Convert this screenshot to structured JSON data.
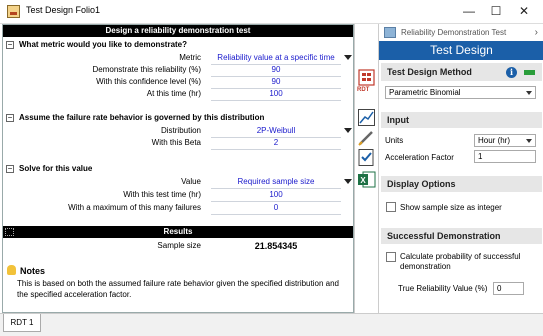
{
  "window": {
    "title": "Test Design Folio1",
    "minimize": "—",
    "maximize": "☐",
    "close": "✕"
  },
  "worksheet": {
    "banner": "Design a reliability demonstration test",
    "metric_section": {
      "header": "What metric would you like to demonstrate?",
      "rows": [
        {
          "label": "Metric",
          "value": "Reliability value at a specific time"
        },
        {
          "label": "Demonstrate this reliability (%)",
          "value": "90"
        },
        {
          "label": "With this confidence level (%)",
          "value": "90"
        },
        {
          "label": "At this time (hr)",
          "value": "100"
        }
      ]
    },
    "failure_section": {
      "header": "Assume the failure rate behavior is governed by this distribution",
      "rows": [
        {
          "label": "Distribution",
          "value": "2P-Weibull"
        },
        {
          "label": "With this Beta",
          "value": "2"
        }
      ]
    },
    "solve_section": {
      "header": "Solve for this value",
      "rows": [
        {
          "label": "Value",
          "value": "Required sample size"
        },
        {
          "label": "With this test time (hr)",
          "value": "100"
        },
        {
          "label": "With a maximum of this many failures",
          "value": "0"
        }
      ]
    },
    "results": {
      "banner": "Results",
      "label": "Sample size",
      "value": "21.854345"
    },
    "notes": {
      "title": "Notes",
      "text": "This is based on both the assumed failure rate behavior given the specified distribution and the specified acceleration factor."
    }
  },
  "statusbar": {
    "tab": "RDT 1"
  },
  "toolbar": {
    "icons": [
      "calculate-icon",
      "rdt-icon",
      "plot-icon",
      "edit-icon",
      "check-icon",
      "excel-icon"
    ],
    "rdt_label": "RDT"
  },
  "panel": {
    "top_label": "Reliability Demonstration Test",
    "title": "Test Design",
    "method": {
      "header": "Test Design Method",
      "selected": "Parametric Binomial"
    },
    "input": {
      "header": "Input",
      "units_label": "Units",
      "units_value": "Hour (hr)",
      "accel_label": "Acceleration Factor",
      "accel_value": "1"
    },
    "display": {
      "header": "Display Options",
      "checkbox_label": "Show sample size as integer"
    },
    "success": {
      "header": "Successful Demonstration",
      "checkbox_label": "Calculate probability of successful demonstration",
      "true_rel_label": "True Reliability Value (%)",
      "true_rel_value": "0"
    }
  },
  "colors": {
    "accent": "#1b5fa8",
    "value_text": "#1a1acc",
    "status_green": "#2a9d3a"
  }
}
